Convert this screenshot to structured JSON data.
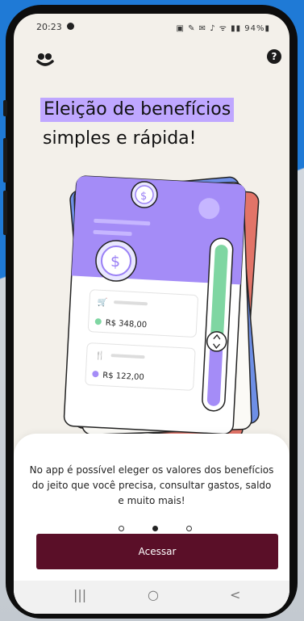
{
  "status_bar": {
    "time": "20:23",
    "indicators": "94%"
  },
  "header": {
    "logo_icon": "brand-logo-icon",
    "help_label": "?"
  },
  "hero": {
    "title_line1": "Eleição de benefícios",
    "title_line2": "simples e rápida!",
    "highlight_color": "#bfa7ff"
  },
  "illustration": {
    "coin_symbol": "$",
    "row1_value": "R$ 348,00",
    "row2_value": "R$ 122,00",
    "card_accent": "#a48cf7",
    "slider_green": "#7fd6a2",
    "slider_purple": "#a48cf7"
  },
  "onboarding": {
    "description": "No app é possível eleger os valores dos benefícios do jeito que você precisa, consultar gastos, saldo e muito mais!",
    "pages": 3,
    "active_page": 2,
    "cta_label": "Acessar",
    "cta_color": "#5a0f28"
  },
  "navbar": {
    "recents_icon": "|||",
    "home_icon": "○",
    "back_icon": "<"
  }
}
